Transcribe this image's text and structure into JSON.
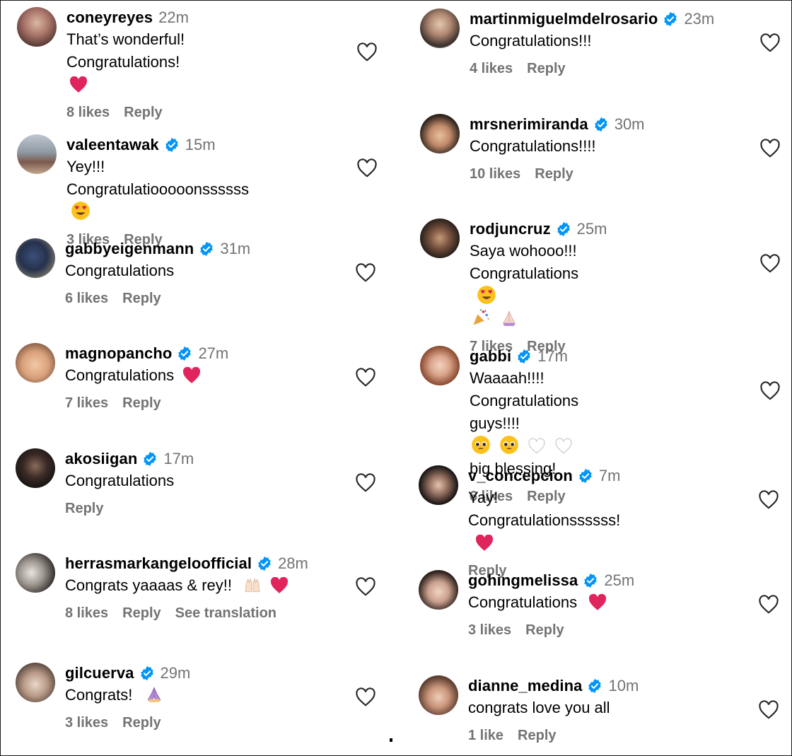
{
  "left": [
    {
      "username": "coneyreyes",
      "verified": false,
      "time": "22m",
      "text": "That’s wonderful! Congratulations!",
      "likes": "8 likes",
      "reply": "Reply"
    },
    {
      "username": "valeentawak",
      "verified": true,
      "time": "15m",
      "text": "Yey!!! Congratulatiooooonssssss",
      "likes": "3 likes",
      "reply": "Reply"
    },
    {
      "username": "gabbyeigenmann",
      "verified": true,
      "time": "31m",
      "text": "Congratulations",
      "likes": "6 likes",
      "reply": "Reply"
    },
    {
      "username": "magnopancho",
      "verified": true,
      "time": "27m",
      "text": "Congratulations",
      "likes": "7 likes",
      "reply": "Reply"
    },
    {
      "username": "akosiigan",
      "verified": true,
      "time": "17m",
      "text": "Congratulations",
      "likes": "",
      "reply": "Reply"
    },
    {
      "username": "herrasmarkangeloofficial",
      "verified": true,
      "time": "28m",
      "text": "Congrats yaaaas & rey!!",
      "likes": "8 likes",
      "reply": "Reply",
      "see_translation": "See translation"
    },
    {
      "username": "gilcuerva",
      "verified": true,
      "time": "29m",
      "text": "Congrats!",
      "likes": "3 likes",
      "reply": "Reply"
    }
  ],
  "right": [
    {
      "username": "martinmiguelmdelrosario",
      "verified": true,
      "time": "23m",
      "text": "Congratulations!!!",
      "likes": "4 likes",
      "reply": "Reply"
    },
    {
      "username": "mrsnerimiranda",
      "verified": true,
      "time": "30m",
      "text": "Congratulations!!!!",
      "likes": "10 likes",
      "reply": "Reply"
    },
    {
      "username": "rodjuncruz",
      "verified": true,
      "time": "25m",
      "text": "Saya wohooo!!! Congratulations",
      "likes": "7 likes",
      "reply": "Reply"
    },
    {
      "username": "gabbi",
      "verified": true,
      "time": "17m",
      "text": "Waaaah!!!! Congratulations guys!!!!",
      "text2": "big blessing!",
      "likes": "6 likes",
      "reply": "Reply"
    },
    {
      "username": "v_concepcion",
      "verified": true,
      "time": "7m",
      "text": "Yay! Congratulationssssss!",
      "likes": "",
      "reply": "Reply"
    },
    {
      "username": "gohingmelissa",
      "verified": true,
      "time": "25m",
      "text": "Congratulations",
      "likes": "3 likes",
      "reply": "Reply"
    },
    {
      "username": "dianne_medina",
      "verified": true,
      "time": "10m",
      "text": "congrats love you all",
      "likes": "1 like",
      "reply": "Reply"
    }
  ],
  "icons": {
    "verified": "verified-badge-icon",
    "like": "heart-outline-icon"
  },
  "colors": {
    "verified": "#0095f6",
    "secondary_text": "#737373",
    "red_heart": "#e0245e"
  }
}
